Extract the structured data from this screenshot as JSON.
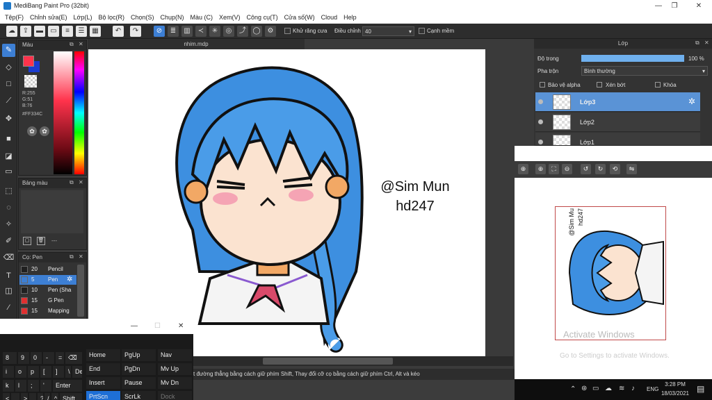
{
  "window": {
    "title": "MediBang Paint Pro (32bit)",
    "minimize": "—",
    "maximize": "❐",
    "close": "✕"
  },
  "menu": [
    "Tệp(F)",
    "Chỉnh sửa(E)",
    "Lớp(L)",
    "Bộ lọc(R)",
    "Chọn(S)",
    "Chụp(N)",
    "Màu (C)",
    "Xem(V)",
    "Công cụ(T)",
    "Cửa số(W)",
    "Cloud",
    "Help"
  ],
  "toolbar": {
    "antialias_label": "Khử răng cưa",
    "adjust_label": "Điều chỉnh",
    "adjust_value": "40",
    "edge_label": "Cạnh mềm"
  },
  "color_panel": {
    "title": "Màu",
    "r": "R:255",
    "g": "G:51",
    "b": "B:76",
    "hex": "#FF334C",
    "primary_color": "#FF334C"
  },
  "palette_panel": {
    "title": "Bảng màu",
    "footer": "---"
  },
  "brush_panel": {
    "title": "Cọ: Pen",
    "items": [
      {
        "size": "20",
        "name": "Pencil",
        "color": "#202020"
      },
      {
        "size": "5",
        "name": "Pen",
        "color": "#3d7fd4"
      },
      {
        "size": "10",
        "name": "Pen (Sha",
        "color": "#202020"
      },
      {
        "size": "15",
        "name": "G Pen",
        "color": "#e03030"
      },
      {
        "size": "15",
        "name": "Mapping",
        "color": "#e03030"
      }
    ]
  },
  "canvas": {
    "tab": "nhim.mdp",
    "watermark_line1": "@Sim Mun",
    "watermark_line2": "hd247"
  },
  "layer_panel": {
    "title": "Lớp",
    "opacity_label": "Độ trong",
    "opacity_value": "100 %",
    "opacity_fraction": 1.0,
    "blend_label": "Pha trộn",
    "blend_value": "Bình thường",
    "protect_alpha": "Bảo vệ alpha",
    "clipping": "Xén bớt",
    "lock": "Khóa",
    "layers": [
      "Lớp3",
      "Lớp2",
      "Lớp1"
    ]
  },
  "navigator": {
    "watermark_line1": "@Sim Mu",
    "watermark_line2": "hd247",
    "activate_title": "Activate Windows",
    "activate_sub": "Go to Settings to activate Windows."
  },
  "status": {
    "text": "t đường thẳng bằng cách giữ phím Shift, Thay đổi cỡ cọ bằng cách giữ phím Ctrl, Alt và kéo"
  },
  "keyboard": {
    "title_min": "—",
    "title_max": "☐",
    "title_close": "✕",
    "row1": [
      "8",
      "9",
      "0",
      "-",
      "=",
      "⌫"
    ],
    "row2": [
      "i",
      "o",
      "p",
      "[",
      "]",
      "\\",
      "Del"
    ],
    "row3": [
      "k",
      "l",
      ";",
      "'",
      "Enter"
    ],
    "row4": [
      "<",
      ",",
      ">",
      ".",
      "?",
      "/",
      "^",
      "Shift"
    ],
    "nav_col1": [
      "Home",
      "End",
      "Insert",
      "PrtScn"
    ],
    "nav_col2": [
      "PgUp",
      "PgDn",
      "Pause",
      "ScrLk"
    ],
    "nav_col3": [
      "Nav",
      "Mv Up",
      "Mv Dn",
      "Dock"
    ]
  },
  "taskbar": {
    "lang": "ENG",
    "time": "3:28 PM",
    "date": "18/03/2021"
  }
}
